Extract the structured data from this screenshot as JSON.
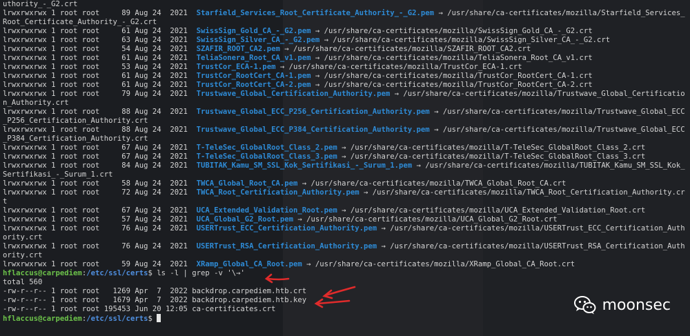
{
  "terminal": {
    "lines": [
      {
        "text": "uthority_-_G2.crt"
      },
      {
        "perm": "lrwxrwxrwx 1 root root     89 Aug 24  2021  ",
        "name": "Starfield_Services_Root_Certificate_Authority_-_G2.pem",
        "arrow": " → ",
        "target": "/usr/share/ca-certificates/mozilla/Starfield_Services_"
      },
      {
        "text": "Root_Certificate_Authority_-_G2.crt"
      },
      {
        "perm": "lrwxrwxrwx 1 root root     61 Aug 24  2021  ",
        "name": "SwissSign_Gold_CA_-_G2.pem",
        "arrow": " → ",
        "target": "/usr/share/ca-certificates/mozilla/SwissSign_Gold_CA_-_G2.crt"
      },
      {
        "perm": "lrwxrwxrwx 1 root root     63 Aug 24  2021  ",
        "name": "SwissSign_Silver_CA_-_G2.pem",
        "arrow": " → ",
        "target": "/usr/share/ca-certificates/mozilla/SwissSign_Silver_CA_-_G2.crt"
      },
      {
        "perm": "lrwxrwxrwx 1 root root     54 Aug 24  2021  ",
        "name": "SZAFIR_ROOT_CA2.pem",
        "arrow": " → ",
        "target": "/usr/share/ca-certificates/mozilla/SZAFIR_ROOT_CA2.crt"
      },
      {
        "perm": "lrwxrwxrwx 1 root root     61 Aug 24  2021  ",
        "name": "TeliaSonera_Root_CA_v1.pem",
        "arrow": " → ",
        "target": "/usr/share/ca-certificates/mozilla/TeliaSonera_Root_CA_v1.crt"
      },
      {
        "perm": "lrwxrwxrwx 1 root root     53 Aug 24  2021  ",
        "name": "TrustCor_ECA-1.pem",
        "arrow": " → ",
        "target": "/usr/share/ca-certificates/mozilla/TrustCor_ECA-1.crt"
      },
      {
        "perm": "lrwxrwxrwx 1 root root     61 Aug 24  2021  ",
        "name": "TrustCor_RootCert_CA-1.pem",
        "arrow": " → ",
        "target": "/usr/share/ca-certificates/mozilla/TrustCor_RootCert_CA-1.crt"
      },
      {
        "perm": "lrwxrwxrwx 1 root root     61 Aug 24  2021  ",
        "name": "TrustCor_RootCert_CA-2.pem",
        "arrow": " → ",
        "target": "/usr/share/ca-certificates/mozilla/TrustCor_RootCert_CA-2.crt"
      },
      {
        "perm": "lrwxrwxrwx 1 root root     79 Aug 24  2021  ",
        "name": "Trustwave_Global_Certification_Authority.pem",
        "arrow": " → ",
        "target": "/usr/share/ca-certificates/mozilla/Trustwave_Global_Certificatio"
      },
      {
        "text": "n_Authority.crt"
      },
      {
        "perm": "lrwxrwxrwx 1 root root     88 Aug 24  2021  ",
        "name": "Trustwave_Global_ECC_P256_Certification_Authority.pem",
        "arrow": " → ",
        "target": "/usr/share/ca-certificates/mozilla/Trustwave_Global_ECC"
      },
      {
        "text": "_P256_Certification_Authority.crt"
      },
      {
        "perm": "lrwxrwxrwx 1 root root     88 Aug 24  2021  ",
        "name": "Trustwave_Global_ECC_P384_Certification_Authority.pem",
        "arrow": " → ",
        "target": "/usr/share/ca-certificates/mozilla/Trustwave_Global_ECC"
      },
      {
        "text": "_P384_Certification_Authority.crt"
      },
      {
        "perm": "lrwxrwxrwx 1 root root     67 Aug 24  2021  ",
        "name": "T-TeleSec_GlobalRoot_Class_2.pem",
        "arrow": " → ",
        "target": "/usr/share/ca-certificates/mozilla/T-TeleSec_GlobalRoot_Class_2.crt"
      },
      {
        "perm": "lrwxrwxrwx 1 root root     67 Aug 24  2021  ",
        "name": "T-TeleSec_GlobalRoot_Class_3.pem",
        "arrow": " → ",
        "target": "/usr/share/ca-certificates/mozilla/T-TeleSec_GlobalRoot_Class_3.crt"
      },
      {
        "perm": "lrwxrwxrwx 1 root root     84 Aug 24  2021  ",
        "name": "TUBITAK_Kamu_SM_SSL_Kok_Sertifikasi_-_Surum_1.pem",
        "arrow": " → ",
        "target": "/usr/share/ca-certificates/mozilla/TUBITAK_Kamu_SM_SSL_Kok_"
      },
      {
        "text": "Sertifikasi_-_Surum_1.crt"
      },
      {
        "perm": "lrwxrwxrwx 1 root root     58 Aug 24  2021  ",
        "name": "TWCA_Global_Root_CA.pem",
        "arrow": " → ",
        "target": "/usr/share/ca-certificates/mozilla/TWCA_Global_Root_CA.crt"
      },
      {
        "perm": "lrwxrwxrwx 1 root root     72 Aug 24  2021  ",
        "name": "TWCA_Root_Certification_Authority.pem",
        "arrow": " → ",
        "target": "/usr/share/ca-certificates/mozilla/TWCA_Root_Certification_Authority.cr"
      },
      {
        "text": "t"
      },
      {
        "perm": "lrwxrwxrwx 1 root root     67 Aug 24  2021  ",
        "name": "UCA_Extended_Validation_Root.pem",
        "arrow": " → ",
        "target": "/usr/share/ca-certificates/mozilla/UCA_Extended_Validation_Root.crt"
      },
      {
        "perm": "lrwxrwxrwx 1 root root     57 Aug 24  2021  ",
        "name": "UCA_Global_G2_Root.pem",
        "arrow": " → ",
        "target": "/usr/share/ca-certificates/mozilla/UCA_Global_G2_Root.crt"
      },
      {
        "perm": "lrwxrwxrwx 1 root root     76 Aug 24  2021  ",
        "name": "USERTrust_ECC_Certification_Authority.pem",
        "arrow": " → ",
        "target": "/usr/share/ca-certificates/mozilla/USERTrust_ECC_Certification_Auth"
      },
      {
        "text": "ority.crt"
      },
      {
        "perm": "lrwxrwxrwx 1 root root     76 Aug 24  2021  ",
        "name": "USERTrust_RSA_Certification_Authority.pem",
        "arrow": " → ",
        "target": "/usr/share/ca-certificates/mozilla/USERTrust_RSA_Certification_Auth"
      },
      {
        "text": "ority.crt"
      },
      {
        "perm": "lrwxrwxrwx 1 root root     59 Aug 24  2021  ",
        "name": "XRamp_Global_CA_Root.pem",
        "arrow": " → ",
        "target": "/usr/share/ca-certificates/mozilla/XRamp_Global_CA_Root.crt"
      },
      {
        "prompt_user": "hflaccus@carpediem",
        "prompt_path": "/etc/ssl/certs",
        "prompt_sep": ":",
        "prompt_dollar": "$ ",
        "command": "ls -l | grep -v '\\→'"
      },
      {
        "text": "total 560"
      },
      {
        "text": "-rw-r--r-- 1 root root   1269 Apr  7  2022 backdrop.carpediem.htb.crt"
      },
      {
        "text": "-rw-r--r-- 1 root root   1679 Apr  7  2022 backdrop.carpediem.htb.key"
      },
      {
        "text": "-rw-r--r-- 1 root root 195453 Jun 20 12:05 ca-certificates.crt"
      },
      {
        "prompt_user": "hflaccus@carpediem",
        "prompt_path": "/etc/ssl/certs",
        "prompt_sep": ":",
        "prompt_dollar": "$ ",
        "command": "",
        "cursor": true
      }
    ]
  },
  "watermark": {
    "text": "moonsec",
    "icon": "wechat-icon"
  },
  "annotations": {
    "color": "#e02b2b",
    "arrows": 3
  }
}
